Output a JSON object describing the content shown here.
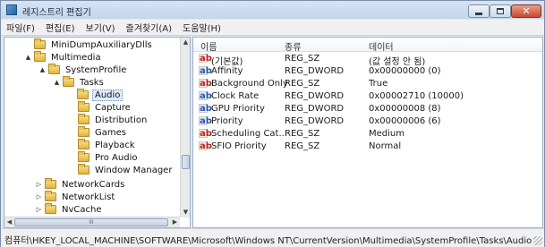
{
  "window": {
    "title": "레지스트리 편집기",
    "controls": {
      "minimize": "minimize",
      "maximize": "maximize",
      "close": "✕"
    }
  },
  "menu": [
    "파일(F)",
    "편집(E)",
    "보기(V)",
    "즐겨찾기(A)",
    "도움말(H)"
  ],
  "tree": {
    "items": [
      {
        "label": "MiniDumpAuxiliaryDlls",
        "expander": "",
        "selected": false
      },
      {
        "label": "Multimedia",
        "expander": "▲",
        "selected": false
      },
      {
        "label": "SystemProfile",
        "expander": "▲",
        "selected": false
      },
      {
        "label": "Tasks",
        "expander": "▲",
        "selected": false
      },
      {
        "label": "Audio",
        "expander": "",
        "selected": true
      },
      {
        "label": "Capture",
        "expander": "",
        "selected": false
      },
      {
        "label": "Distribution",
        "expander": "",
        "selected": false
      },
      {
        "label": "Games",
        "expander": "",
        "selected": false
      },
      {
        "label": "Playback",
        "expander": "",
        "selected": false
      },
      {
        "label": "Pro Audio",
        "expander": "",
        "selected": false
      },
      {
        "label": "Window Manager",
        "expander": "",
        "selected": false
      },
      {
        "label": "NetworkCards",
        "expander": "▷",
        "selected": false
      },
      {
        "label": "NetworkList",
        "expander": "▷",
        "selected": false
      },
      {
        "label": "NvCache",
        "expander": "▷",
        "selected": false
      }
    ]
  },
  "values": {
    "columns": [
      "이름",
      "종류",
      "데이터"
    ],
    "rows": [
      {
        "icon": "ab",
        "type_class": "sz",
        "name": "(기본값)",
        "type": "REG_SZ",
        "data": "(값 설정 안 됨)"
      },
      {
        "icon": "ab",
        "type_class": "dw",
        "name": "Affinity",
        "type": "REG_DWORD",
        "data": "0x00000000 (0)"
      },
      {
        "icon": "ab",
        "type_class": "sz",
        "name": "Background Only",
        "type": "REG_SZ",
        "data": "True"
      },
      {
        "icon": "ab",
        "type_class": "dw",
        "name": "Clock Rate",
        "type": "REG_DWORD",
        "data": "0x00002710 (10000)"
      },
      {
        "icon": "ab",
        "type_class": "dw",
        "name": "GPU Priority",
        "type": "REG_DWORD",
        "data": "0x00000008 (8)"
      },
      {
        "icon": "ab",
        "type_class": "dw",
        "name": "Priority",
        "type": "REG_DWORD",
        "data": "0x00000006 (6)"
      },
      {
        "icon": "ab",
        "type_class": "sz",
        "name": "Scheduling Cat...",
        "type": "REG_SZ",
        "data": "Medium"
      },
      {
        "icon": "ab",
        "type_class": "sz",
        "name": "SFIO Priority",
        "type": "REG_SZ",
        "data": "Normal"
      }
    ]
  },
  "statusbar": {
    "path": "컴퓨터\\HKEY_LOCAL_MACHINE\\SOFTWARE\\Microsoft\\Windows NT\\CurrentVersion\\Multimedia\\SystemProfile\\Tasks\\Audio"
  },
  "scroll": {
    "up": "▲",
    "down": "▼",
    "left": "◀",
    "right": "▶",
    "thumb_grip": "III"
  }
}
